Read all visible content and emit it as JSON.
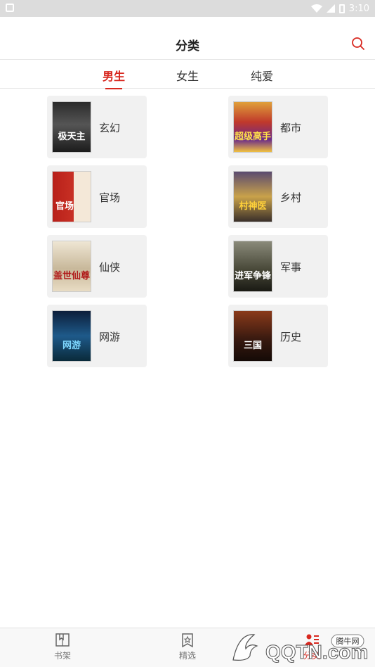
{
  "status_bar": {
    "time": "3:10"
  },
  "header": {
    "title": "分类",
    "search_icon": "search-icon"
  },
  "tabs": [
    {
      "label": "男生",
      "active": true
    },
    {
      "label": "女生",
      "active": false
    },
    {
      "label": "纯爱",
      "active": false
    }
  ],
  "categories": [
    {
      "label": "玄幻",
      "cover_text": "极天主"
    },
    {
      "label": "都市",
      "cover_text": "超级高手"
    },
    {
      "label": "官场",
      "cover_text": "官场"
    },
    {
      "label": "乡村",
      "cover_text": "村神医"
    },
    {
      "label": "仙侠",
      "cover_text": "盖世仙尊"
    },
    {
      "label": "军事",
      "cover_text": "进军争锋"
    },
    {
      "label": "网游",
      "cover_text": "网游"
    },
    {
      "label": "历史",
      "cover_text": "三国"
    }
  ],
  "bottom_nav": [
    {
      "label": "书架",
      "icon": "bookshelf-icon"
    },
    {
      "label": "精选",
      "icon": "featured-icon"
    },
    {
      "label": "分类",
      "icon": "category-icon"
    }
  ],
  "watermark": {
    "text_top": "腾牛网",
    "text_main": "QQTN.com"
  },
  "colors": {
    "accent": "#d8281f",
    "card_bg": "#f1f1f1",
    "status_bar": "#dcdcdc"
  }
}
